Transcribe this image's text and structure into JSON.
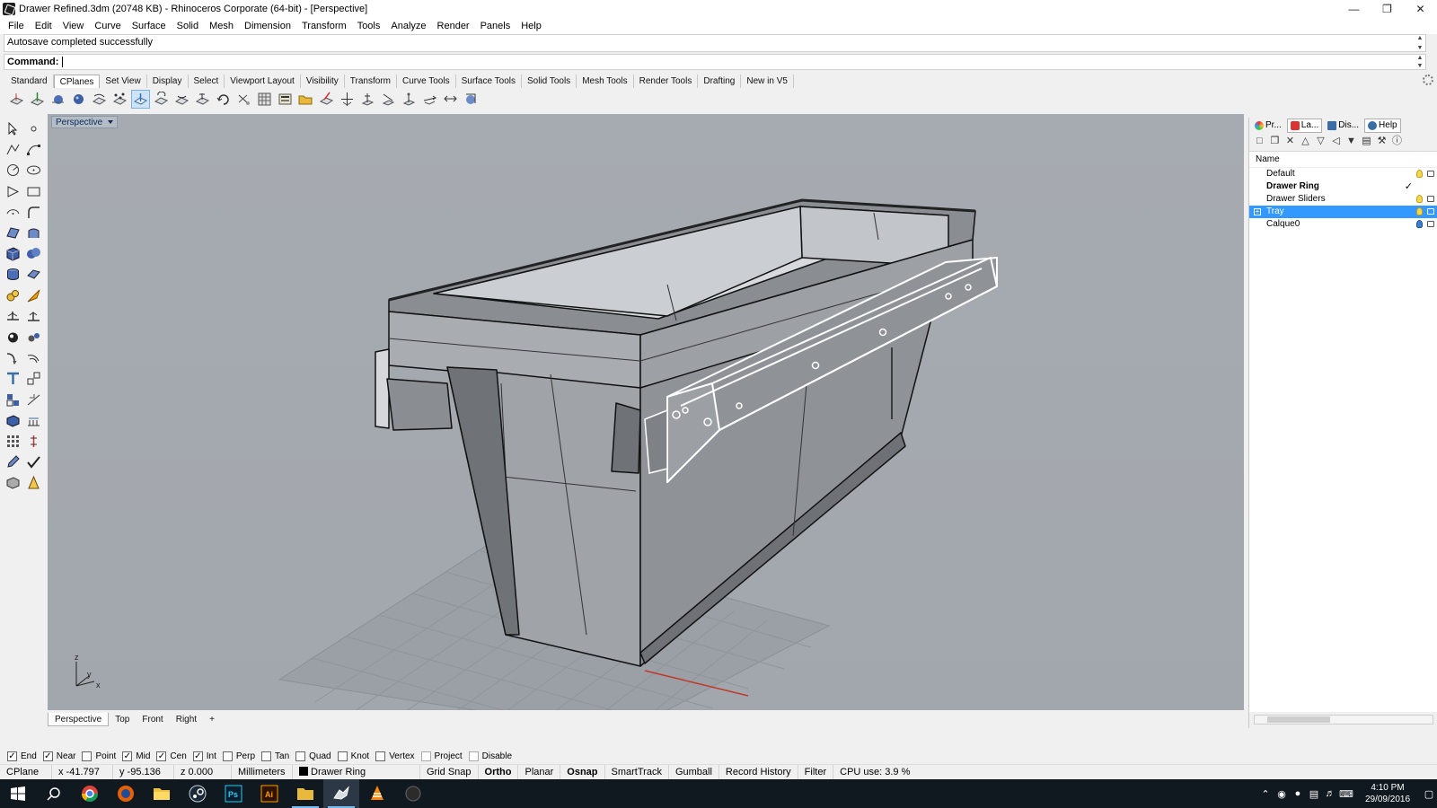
{
  "window": {
    "title": "Drawer Refined.3dm (20748 KB) - Rhinoceros Corporate (64-bit) - [Perspective]",
    "controls": [
      "minimize",
      "restore",
      "close"
    ]
  },
  "menu": [
    "File",
    "Edit",
    "View",
    "Curve",
    "Surface",
    "Solid",
    "Mesh",
    "Dimension",
    "Transform",
    "Tools",
    "Analyze",
    "Render",
    "Panels",
    "Help"
  ],
  "command": {
    "history": "Autosave completed successfully",
    "prompt_label": "Command:",
    "value": ""
  },
  "toolbar_tabs": [
    {
      "label": "Standard",
      "active": false
    },
    {
      "label": "CPlanes",
      "active": true
    },
    {
      "label": "Set View",
      "active": false
    },
    {
      "label": "Display",
      "active": false
    },
    {
      "label": "Select",
      "active": false
    },
    {
      "label": "Viewport Layout",
      "active": false
    },
    {
      "label": "Visibility",
      "active": false
    },
    {
      "label": "Transform",
      "active": false
    },
    {
      "label": "Curve Tools",
      "active": false
    },
    {
      "label": "Surface Tools",
      "active": false
    },
    {
      "label": "Solid Tools",
      "active": false
    },
    {
      "label": "Mesh Tools",
      "active": false
    },
    {
      "label": "Render Tools",
      "active": false
    },
    {
      "label": "Drafting",
      "active": false
    },
    {
      "label": "New in V5",
      "active": false
    }
  ],
  "viewport": {
    "name": "Perspective",
    "tabs": [
      {
        "label": "Perspective",
        "active": true
      },
      {
        "label": "Top",
        "active": false
      },
      {
        "label": "Front",
        "active": false
      },
      {
        "label": "Right",
        "active": false
      },
      {
        "label": "+",
        "active": false
      }
    ],
    "axes": {
      "x": "x",
      "y": "y",
      "z": "z"
    }
  },
  "panel": {
    "tabs": [
      {
        "label": "Pr...",
        "icon": "properties-icon",
        "active": false
      },
      {
        "label": "La...",
        "icon": "layers-icon",
        "active": true
      },
      {
        "label": "Dis...",
        "icon": "display-icon",
        "active": false
      },
      {
        "label": "Help",
        "icon": "help-icon",
        "active": false
      }
    ],
    "column_header": "Name",
    "layers": [
      {
        "name": "Default",
        "current": false,
        "selected": false,
        "color": "#000000"
      },
      {
        "name": "Drawer Ring",
        "current": true,
        "selected": false,
        "color": "#000000"
      },
      {
        "name": "Drawer Sliders",
        "current": false,
        "selected": false,
        "color": "#000000"
      },
      {
        "name": "Tray",
        "current": false,
        "selected": true,
        "color": "#000000"
      },
      {
        "name": "Calque0",
        "current": false,
        "selected": false,
        "color": "#3c7fd0"
      }
    ]
  },
  "osnaps": [
    {
      "label": "End",
      "checked": true
    },
    {
      "label": "Near",
      "checked": true
    },
    {
      "label": "Point",
      "checked": false
    },
    {
      "label": "Mid",
      "checked": true
    },
    {
      "label": "Cen",
      "checked": true
    },
    {
      "label": "Int",
      "checked": true
    },
    {
      "label": "Perp",
      "checked": false
    },
    {
      "label": "Tan",
      "checked": false
    },
    {
      "label": "Quad",
      "checked": false
    },
    {
      "label": "Knot",
      "checked": false
    },
    {
      "label": "Vertex",
      "checked": false
    },
    {
      "label": "Project",
      "checked": false
    },
    {
      "label": "Disable",
      "checked": false
    }
  ],
  "status": {
    "cplane": "CPlane",
    "x": "x -41.797",
    "y": "y -95.136",
    "z": "z 0.000",
    "units": "Millimeters",
    "layer": "Drawer Ring",
    "grid_snap": "Grid Snap",
    "ortho": "Ortho",
    "planar": "Planar",
    "osnap": "Osnap",
    "smarttrack": "SmartTrack",
    "gumball": "Gumball",
    "record_history": "Record History",
    "filter": "Filter",
    "cpu": "CPU use: 3.9 %"
  },
  "taskbar": {
    "apps": [
      "windows-start-icon",
      "search-icon",
      "chrome-icon",
      "firefox-icon",
      "file-explorer-icon",
      "steam-icon",
      "photoshop-icon",
      "illustrator-icon",
      "folder-icon",
      "rhino-icon",
      "vlc-icon",
      "unity-icon"
    ],
    "time": "4:10 PM",
    "date": "29/09/2016"
  }
}
